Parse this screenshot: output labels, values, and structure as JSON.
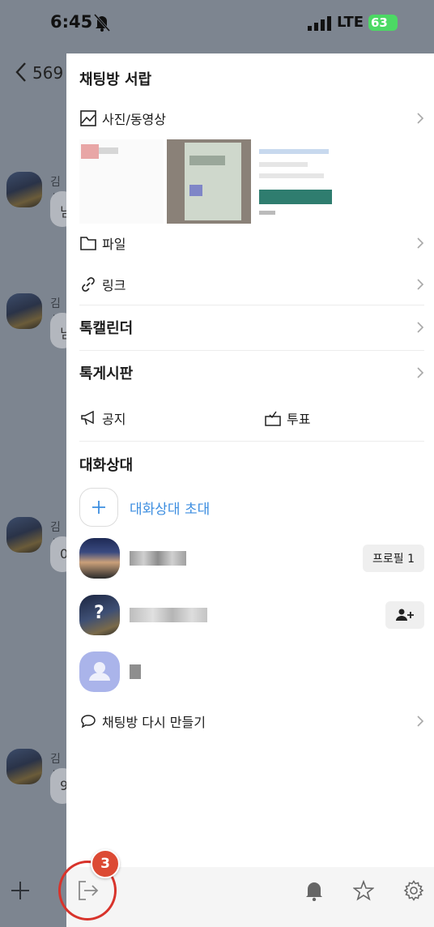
{
  "status_bar": {
    "time": "6:45",
    "network": "LTE",
    "battery": "63"
  },
  "background_chat": {
    "header_number": "569",
    "messages": [
      {
        "name": "김시",
        "bubble": "님"
      },
      {
        "name": "김시",
        "bubble": "님"
      },
      {
        "name": "김시",
        "bubble": "0"
      },
      {
        "name": "김시",
        "bubble": "9"
      }
    ]
  },
  "drawer": {
    "title": "채팅방 서랍",
    "media": {
      "label": "사진/동영상"
    },
    "files": {
      "label": "파일"
    },
    "links": {
      "label": "링크"
    },
    "calendar": {
      "label": "톡캘린더"
    },
    "board": {
      "label": "톡게시판"
    },
    "notice": {
      "label": "공지"
    },
    "vote": {
      "label": "투표"
    },
    "members": {
      "title": "대화상대",
      "invite_label": "대화상대 초대",
      "list": [
        {
          "action_label": "프로필 1"
        },
        {
          "action_label": ""
        },
        {
          "action_label": ""
        }
      ]
    },
    "recreate": {
      "label": "채팅방 다시 만들기"
    }
  },
  "annotation": {
    "step_number": "3"
  },
  "colors": {
    "accent_blue": "#3d8ee0",
    "badge_red": "#dc4a34",
    "dim_overlay": "#7d8590",
    "battery_green": "#4cd964"
  }
}
